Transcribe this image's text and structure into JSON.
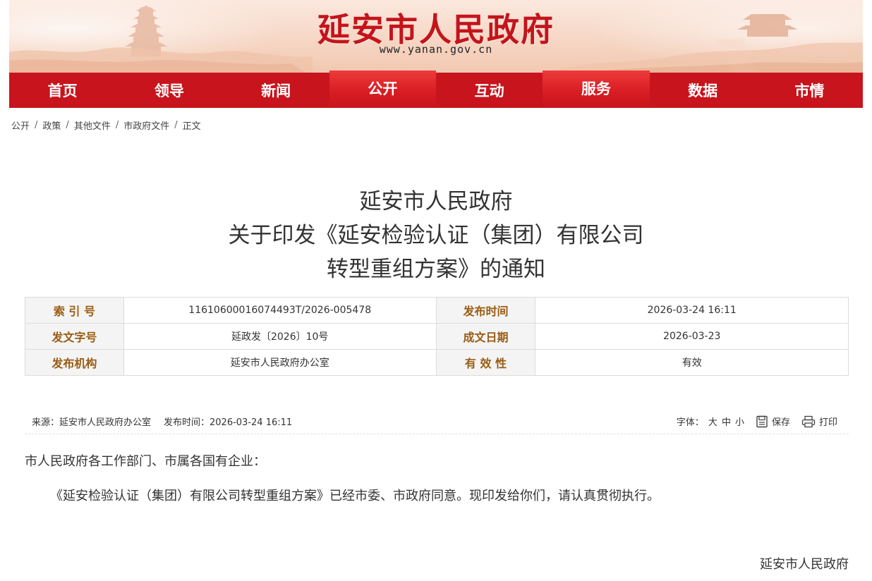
{
  "header": {
    "site_title": "延安市人民政府",
    "site_url": "www.yanan.gov.cn",
    "brand_color": "#c8141c"
  },
  "nav": {
    "items": [
      {
        "label": "首页",
        "active": false
      },
      {
        "label": "领导",
        "active": false
      },
      {
        "label": "新闻",
        "active": false
      },
      {
        "label": "公开",
        "active": true
      },
      {
        "label": "互动",
        "active": false
      },
      {
        "label": "服务",
        "active": true
      },
      {
        "label": "数据",
        "active": false
      },
      {
        "label": "市情",
        "active": false
      }
    ]
  },
  "breadcrumb": {
    "items": [
      "公开",
      "政策",
      "其他文件",
      "市政府文件",
      "正文"
    ],
    "separator": "/"
  },
  "document": {
    "title_lines": [
      "延安市人民政府",
      "关于印发《延安检验认证（集团）有限公司",
      "转型重组方案》的通知"
    ]
  },
  "info_table": {
    "rows": [
      {
        "label1": "索 引 号",
        "value1": "11610600016074493T/2026-005478",
        "label2": "发布时间",
        "value2": "2026-03-24 16:11"
      },
      {
        "label1": "发文字号",
        "value1": "延政发〔2026〕10号",
        "label2": "成文日期",
        "value2": "2026-03-23"
      },
      {
        "label1": "发布机构",
        "value1": "延安市人民政府办公室",
        "label2": "有 效 性",
        "value2": "有效"
      }
    ]
  },
  "meta": {
    "source": "来源：延安市人民政府办公室",
    "publish_time": "发布时间：2026-03-24 16:11",
    "font_label": "字体：",
    "font_options": [
      "大",
      "中",
      "小"
    ],
    "save_label": "保存",
    "print_label": "打印"
  },
  "body": {
    "salutation": "市人民政府各工作部门、市属各国有企业：",
    "paragraph": "《延安检验认证（集团）有限公司转型重组方案》已经市委、市政府同意。现印发给你们，请认真贯彻执行。",
    "signature": "延安市人民政府"
  }
}
